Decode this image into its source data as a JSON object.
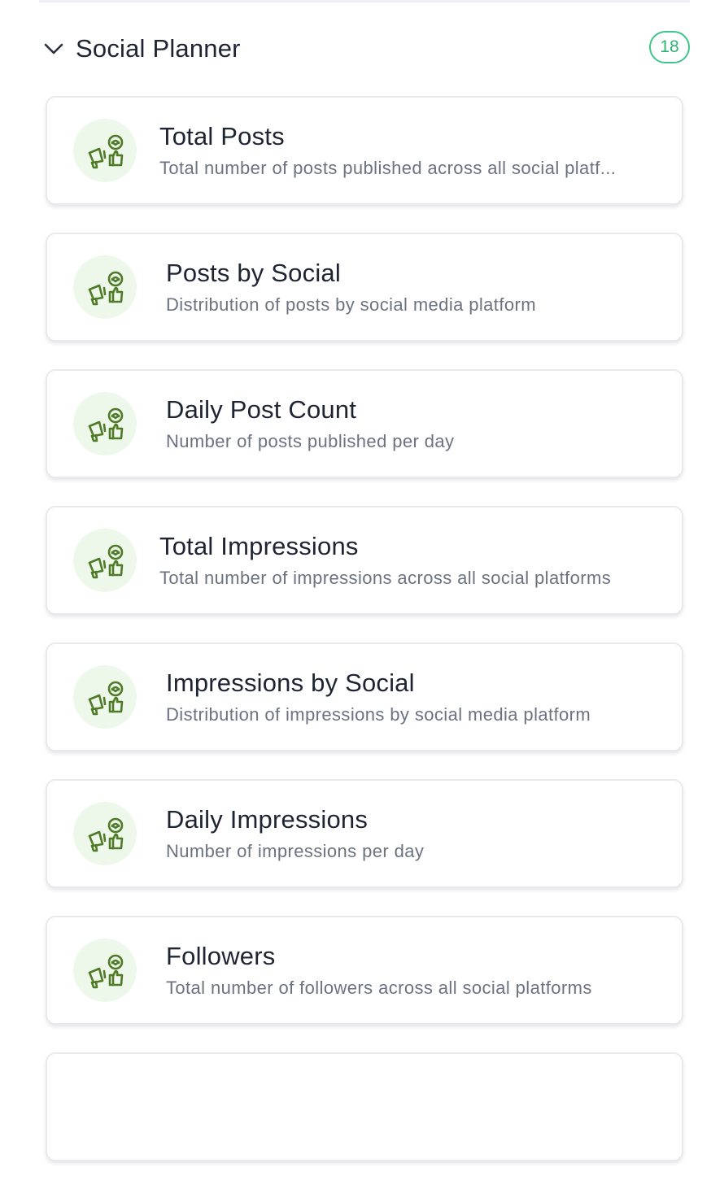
{
  "section": {
    "title": "Social Planner",
    "count": "18"
  },
  "cards": [
    {
      "title": "Total Posts",
      "description": "Total number of posts published across all social platf..."
    },
    {
      "title": "Posts by Social",
      "description": "Distribution of posts by social media platform"
    },
    {
      "title": "Daily Post Count",
      "description": "Number of posts published per day"
    },
    {
      "title": "Total Impressions",
      "description": "Total number of impressions across all social platforms"
    },
    {
      "title": "Impressions by Social",
      "description": "Distribution of impressions by social media platform"
    },
    {
      "title": "Daily Impressions",
      "description": "Number of impressions per day"
    },
    {
      "title": "Followers",
      "description": "Total number of followers across all social platforms"
    }
  ],
  "icons": {
    "card_icon": "megaphone-like-icon",
    "collapse_icon": "chevron-down-icon"
  },
  "colors": {
    "accent": "#3fc489",
    "icon_green": "#4f7a28",
    "icon_bg": "#eef8ea"
  }
}
